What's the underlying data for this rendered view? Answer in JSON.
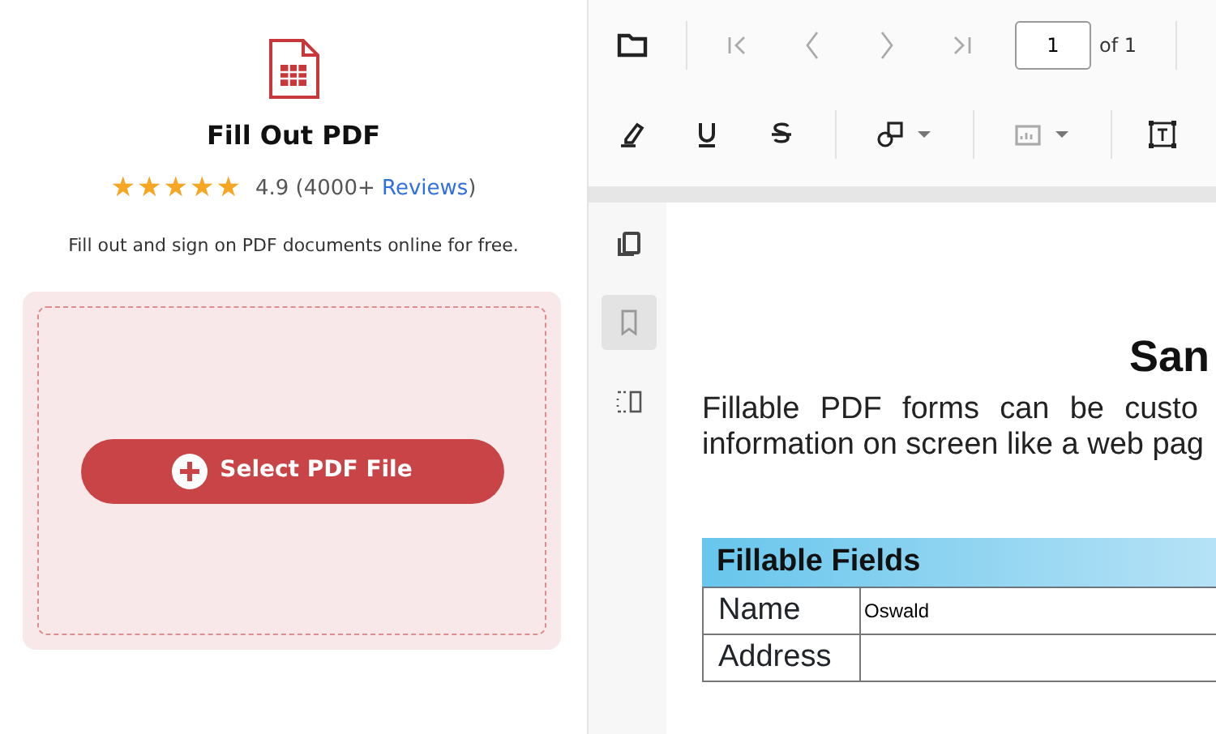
{
  "tool": {
    "title": "Fill Out PDF",
    "stars": 5,
    "rating": "4.9",
    "reviews_prefix": "(4000+",
    "reviews_link": "Reviews",
    "reviews_suffix": ")",
    "description": "Fill out and sign on PDF documents online for free.",
    "upload_button": "Select PDF File"
  },
  "toolbar": {
    "row_1": [
      {
        "kind": "folder",
        "disabled": false
      },
      {
        "kind": "sep"
      },
      {
        "kind": "first",
        "disabled": true
      },
      {
        "kind": "prev",
        "disabled": true
      },
      {
        "kind": "next",
        "disabled": true
      },
      {
        "kind": "last",
        "disabled": true
      }
    ],
    "page_input": {
      "value": "1"
    },
    "page_total": "of 1",
    "row_2": [
      {
        "kind": "highlight",
        "disabled": false
      },
      {
        "kind": "underline",
        "disabled": false
      },
      {
        "kind": "strike",
        "disabled": false
      },
      {
        "kind": "sep"
      },
      {
        "kind": "shape",
        "disabled": false,
        "dropdown": true
      },
      {
        "kind": "sep"
      },
      {
        "kind": "image",
        "disabled": true,
        "dropdown": true
      },
      {
        "kind": "sep"
      },
      {
        "kind": "textbox",
        "disabled": false
      }
    ]
  },
  "sidebar": {
    "items": [
      {
        "kind": "pages",
        "selected": false
      },
      {
        "kind": "bookmark",
        "selected": true
      },
      {
        "kind": "layers",
        "selected": false
      }
    ]
  },
  "document": {
    "heading": "San",
    "paragraph_lines": [
      "Fillable PDF forms can be custo",
      "information on screen like a web pag"
    ],
    "table_header": "Fillable Fields",
    "rows": [
      {
        "label": "Name",
        "value": "Oswald"
      },
      {
        "label": "Address"
      }
    ]
  }
}
